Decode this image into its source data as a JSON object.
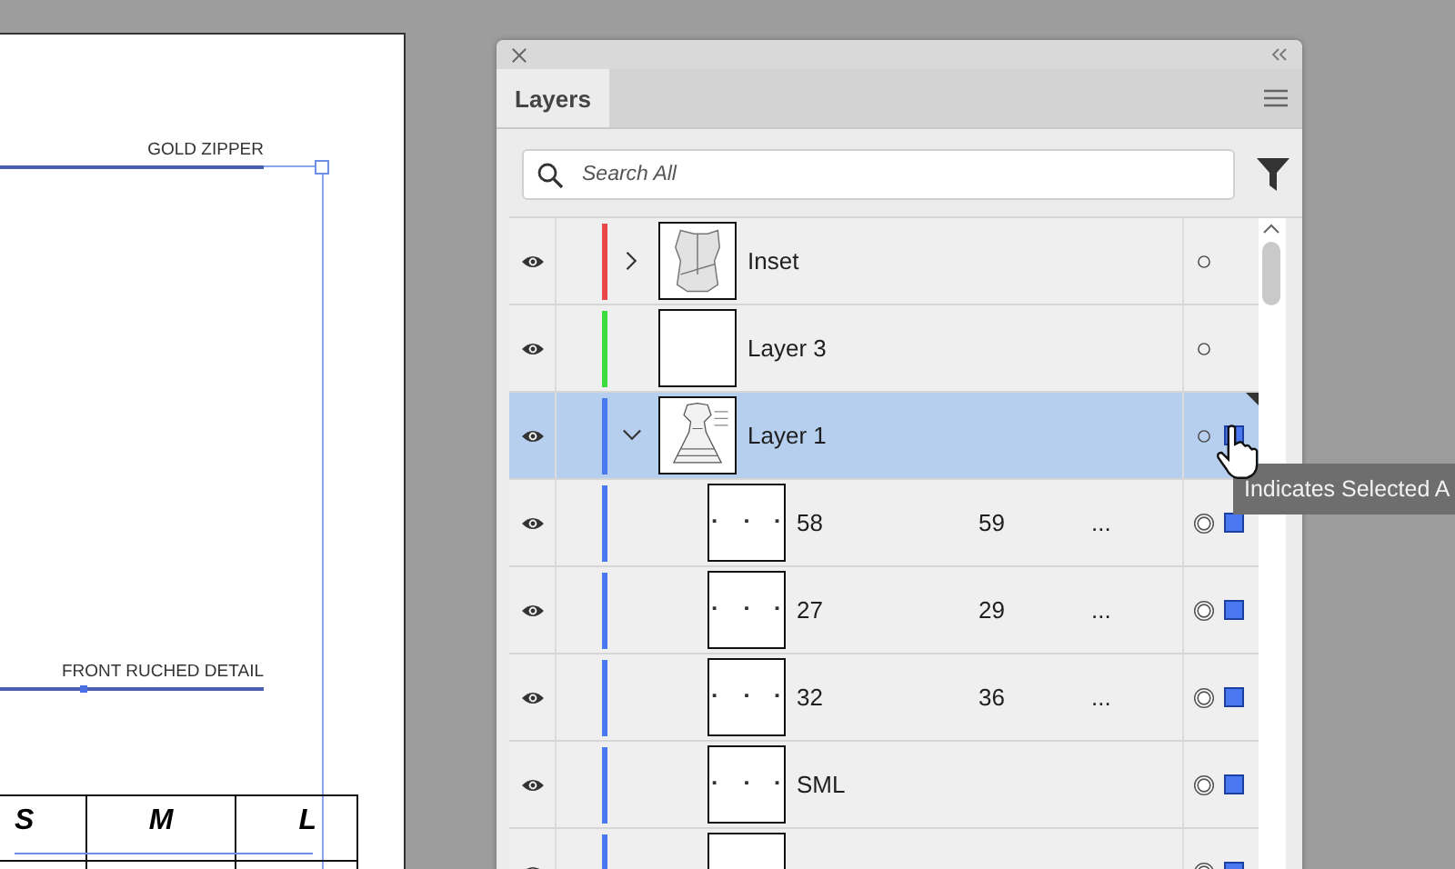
{
  "artboard": {
    "callouts": [
      {
        "label": "GOLD ZIPPER"
      },
      {
        "label": "FRONT RUCHED DETAIL"
      }
    ],
    "size_table": {
      "headers": [
        "S",
        "M",
        "L"
      ]
    }
  },
  "panel": {
    "tabs": [
      {
        "label": "Layers",
        "selected": true
      }
    ],
    "search": {
      "placeholder": "Search All"
    },
    "layers": [
      {
        "name": "Inset",
        "color": "#e84848",
        "visible": true,
        "expanded": false,
        "selected": false,
        "kind": "bodice",
        "targeted": false,
        "has_selection": false
      },
      {
        "name": "Layer 3",
        "color": "#3ddc3d",
        "visible": true,
        "selected": false,
        "kind": "blank",
        "targeted": false,
        "has_selection": false
      },
      {
        "name": "Layer 1",
        "color": "#4a78f0",
        "visible": true,
        "expanded": true,
        "selected": true,
        "kind": "dress",
        "targeted": false,
        "has_selection": true,
        "children": [
          {
            "name": "58",
            "column_2": "59",
            "column_3": "...",
            "color": "#4a78f0",
            "visible": true,
            "selected": false,
            "kind": "marks",
            "targeted": true,
            "has_selection": true
          },
          {
            "name": "27",
            "column_2": "29",
            "column_3": "...",
            "color": "#4a78f0",
            "visible": true,
            "selected": false,
            "kind": "marks",
            "targeted": true,
            "has_selection": true
          },
          {
            "name": "32",
            "column_2": "36",
            "column_3": "...",
            "color": "#4a78f0",
            "visible": true,
            "selected": false,
            "kind": "marks",
            "targeted": true,
            "has_selection": true
          },
          {
            "name": "SML",
            "color": "#4a78f0",
            "visible": true,
            "selected": false,
            "kind": "marks",
            "targeted": true,
            "has_selection": true
          },
          {
            "color": "#4a78f0",
            "visible": true,
            "selected": false,
            "kind": "blank",
            "targeted": true,
            "has_selection": true
          }
        ]
      }
    ]
  },
  "tooltip": {
    "text": "Indicates Selected A"
  }
}
